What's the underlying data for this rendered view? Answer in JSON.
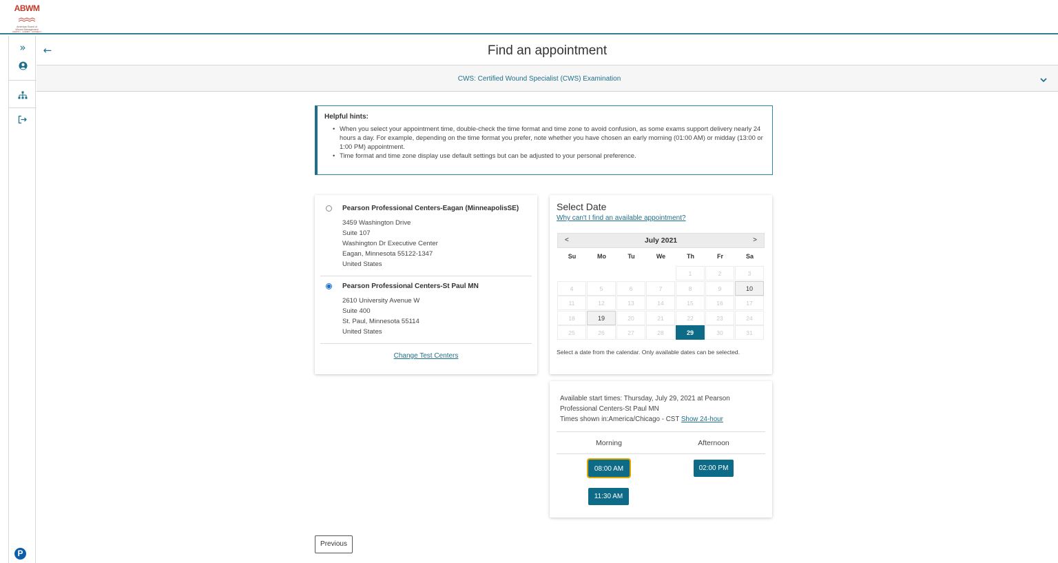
{
  "logo": {
    "abbr": "ABWM",
    "line1": "American Board of",
    "line2": "Wound Management",
    "tagline": "CERTIFY · COMMIT · CONNECT"
  },
  "sidebar": {
    "items": [
      {
        "icon": "expand-chevrons-icon"
      },
      {
        "icon": "user-icon"
      },
      {
        "icon": "sitemap-icon"
      },
      {
        "icon": "sign-out-icon"
      }
    ],
    "footer_icon": "pearson-logo-icon",
    "footer_letter": "P"
  },
  "header": {
    "back_icon": "←",
    "title": "Find an appointment"
  },
  "exam": {
    "name": "CWS: Certified Wound Specialist (CWS) Examination"
  },
  "hints": {
    "title": "Helpful hints:",
    "items": [
      "When you select your appointment time, double-check the time format and time zone to avoid confusion, as some exams support delivery nearly 24 hours a day. For example, depending on the time format you prefer, note whether you have chosen an early morning (01:00 AM) or midday (13:00 or 1:00 PM) appointment.",
      "Time format and time zone display use default settings but can be adjusted to your personal preference."
    ]
  },
  "centers": {
    "items": [
      {
        "name": "Pearson Professional Centers-Eagan (MinneapolisSE)",
        "selected": false,
        "address": [
          "3459 Washington Drive",
          "Suite 107",
          "Washington Dr Executive Center",
          "Eagan, Minnesota 55122-1347",
          "United States"
        ]
      },
      {
        "name": "Pearson Professional Centers-St Paul MN",
        "selected": true,
        "address": [
          "2610 University Avenue W",
          "Suite 400",
          "St. Paul, Minnesota 55114",
          "United States"
        ]
      }
    ],
    "change_link": "Change Test Centers"
  },
  "select_date": {
    "title": "Select Date",
    "help_link": "Why can't I find an available appointment?",
    "prev": "<",
    "next": ">",
    "month": "July 2021",
    "weekdays": [
      "Su",
      "Mo",
      "Tu",
      "We",
      "Th",
      "Fr",
      "Sa"
    ],
    "leading_blanks": 4,
    "days_in_month": 31,
    "available_days": [
      10,
      19
    ],
    "selected_day": 29,
    "note": "Select a date from the calendar. Only available dates can be selected."
  },
  "times": {
    "line1": "Available start times: Thursday, July 29, 2021 at Pearson",
    "line2": "Professional Centers-St Paul MN",
    "tz_prefix": "Times shown in:America/Chicago - CST ",
    "tz_link": "Show 24-hour",
    "morning_label": "Morning",
    "afternoon_label": "Afternoon",
    "morning": [
      "08:00 AM",
      "11:30 AM"
    ],
    "afternoon": [
      "02:00 PM"
    ]
  },
  "footer": {
    "previous": "Previous"
  },
  "colors": {
    "accent": "#0e6b87",
    "link": "#1d6f8a",
    "focus": "#e0a600"
  }
}
